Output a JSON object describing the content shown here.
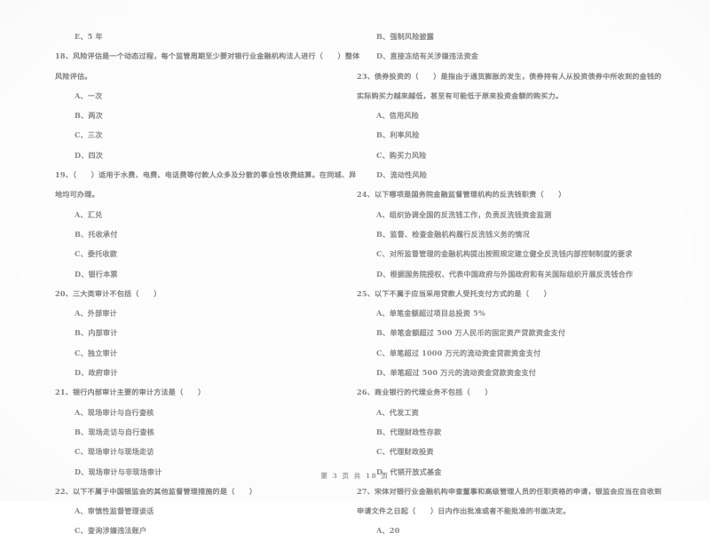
{
  "document": {
    "footer": "第 3 页  共 18 页",
    "page_number": "3",
    "total_pages": "18",
    "text_color": "#858585",
    "background_color": "#fdfdfd"
  },
  "left_column": {
    "orphan_option": "E、5 年",
    "questions": [
      {
        "number": "18",
        "stem_lines": [
          "18、风险评估是一个动态过程，每个监管周期至少要对银行业金融机构法人进行（　　）整体",
          "风险评估。"
        ],
        "options": [
          "A、一次",
          "B、两次",
          "C、三次",
          "D、四次"
        ]
      },
      {
        "number": "19",
        "stem_lines": [
          "19、（　　）适用于水费、电费、电话费等付款人众多及分散的事业性收费结算。在同城、异",
          "地均可办理。"
        ],
        "options": [
          "A、汇兑",
          "B、托收承付",
          "C、委托收款",
          "D、银行本票"
        ]
      },
      {
        "number": "20",
        "stem_lines": [
          "20、三大类审计不包括（　　）"
        ],
        "options": [
          "A、外部审计",
          "B、内部审计",
          "C、独立审计",
          "D、政府审计"
        ]
      },
      {
        "number": "21",
        "stem_lines": [
          "21、银行内部审计主要的审计方法是（　　）"
        ],
        "options": [
          "A、现场审计与自行查核",
          "B、现场走访与自行查核",
          "C、现场审计与现场走访",
          "D、现场审计与非现场审计"
        ]
      },
      {
        "number": "22",
        "stem_lines": [
          "22、以下不属于中国银监会的其他监督管理措施的是（　　）"
        ],
        "options": [
          "A、审慎性监督管理谈话",
          "C、查询涉嫌违法账户"
        ]
      }
    ]
  },
  "right_column": {
    "orphan_options": [
      "B、强制风险披露",
      "D、直接冻结有关涉嫌违法资金"
    ],
    "questions": [
      {
        "number": "23",
        "stem_lines": [
          "23、债券投资的（　　）是指由于通货膨胀的发生，债券持有人从投资债券中所收到的金钱的",
          "实际购买力越来越低，甚至有可能低于原来投资金额的购买力。"
        ],
        "options": [
          "A、信用风险",
          "B、利率风险",
          "C、购买力风险",
          "D、流动性风险"
        ]
      },
      {
        "number": "24",
        "stem_lines": [
          "24、以下哪项是国务院金融监督管理机构的反洗钱职责（　　）"
        ],
        "options": [
          "A、组织协调全国的反洗钱工作，负责反洗钱资金监测",
          "B、监督、检查金融机构履行反洗钱义务的情况",
          "C、对所监督管理的金融机构提出按照规定建立健全反洗钱内部控制制度的要求",
          "D、根据国务院授权、代表中国政府与外国政府和有关国际组织开展反洗钱合作"
        ]
      },
      {
        "number": "25",
        "stem_lines": [
          "25、以下不属于应当采用贷款人受托支付方式的是（　　）"
        ],
        "options": [
          "A、单笔金额超过项目总投资 5%",
          "B、单笔金额超过 500 万人民币的固定资产贷款资金支付",
          "C、单笔超过 1000 万元的流动资金贷款资金支付",
          "D、单笔超过 500 万元的流动资金贷款资金支付"
        ]
      },
      {
        "number": "26",
        "stem_lines": [
          "26、商业银行的代理业务不包括（　　）"
        ],
        "options": [
          "A、代发工资",
          "B、代理财政性存款",
          "C、代理财政投资",
          "D、代销开放式基金"
        ]
      },
      {
        "number": "27",
        "stem_lines": [
          "27、宋体对银行业金融机构申查董事和高级管理人员的任职资格的申请，银监会应当在自收到",
          "申请文件之日起（　　）日内作出批准或者不能批准的书面决定。"
        ],
        "options": [
          "A、20"
        ]
      }
    ]
  }
}
